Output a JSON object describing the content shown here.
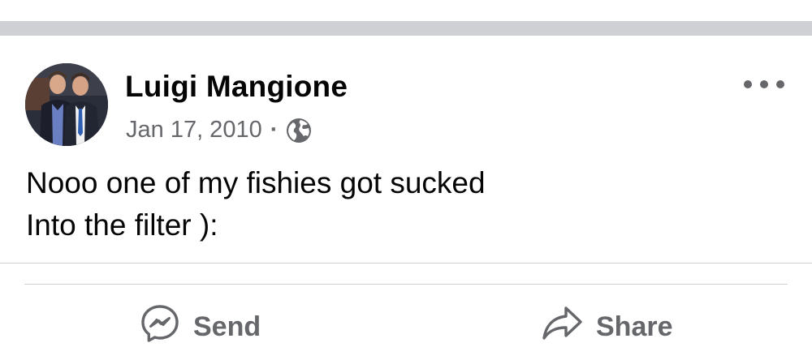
{
  "post": {
    "author_name": "Luigi Mangione",
    "date": "Jan 17, 2010",
    "separator": "·",
    "privacy_icon": "globe-icon",
    "menu_icon": "more-options-icon",
    "text_lines": [
      "Nooo one of my fishies got sucked",
      "Into the filter ):"
    ]
  },
  "actions": {
    "send_label": "Send",
    "send_icon": "messenger-icon",
    "share_label": "Share",
    "share_icon": "share-arrow-icon"
  },
  "colors": {
    "primary_text": "#050505",
    "secondary_text": "#65676b",
    "divider": "#ced0d4",
    "background": "#ffffff"
  }
}
